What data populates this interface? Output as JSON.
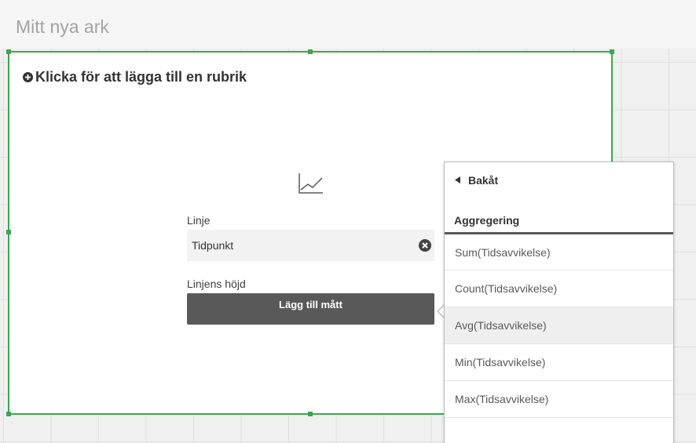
{
  "sheet": {
    "title": "Mitt nya ark"
  },
  "chart": {
    "add_title_label": "Klicka för att lägga till en rubrik",
    "chart_type_icon": "line-chart-icon",
    "dimension": {
      "label": "Linje",
      "value": "Tidpunkt",
      "clear_icon": "close-circle-icon"
    },
    "measure": {
      "label": "Linjens höjd",
      "button_label": "Lägg till mått"
    },
    "selection_color": "#3ca650"
  },
  "popover": {
    "back_label": "Bakåt",
    "section_label": "Aggregering",
    "items": [
      {
        "label": "Sum(Tidsavvikelse)"
      },
      {
        "label": "Count(Tidsavvikelse)"
      },
      {
        "label": "Avg(Tidsavvikelse)",
        "hovered": true
      },
      {
        "label": "Min(Tidsavvikelse)"
      },
      {
        "label": "Max(Tidsavvikelse)"
      }
    ]
  }
}
